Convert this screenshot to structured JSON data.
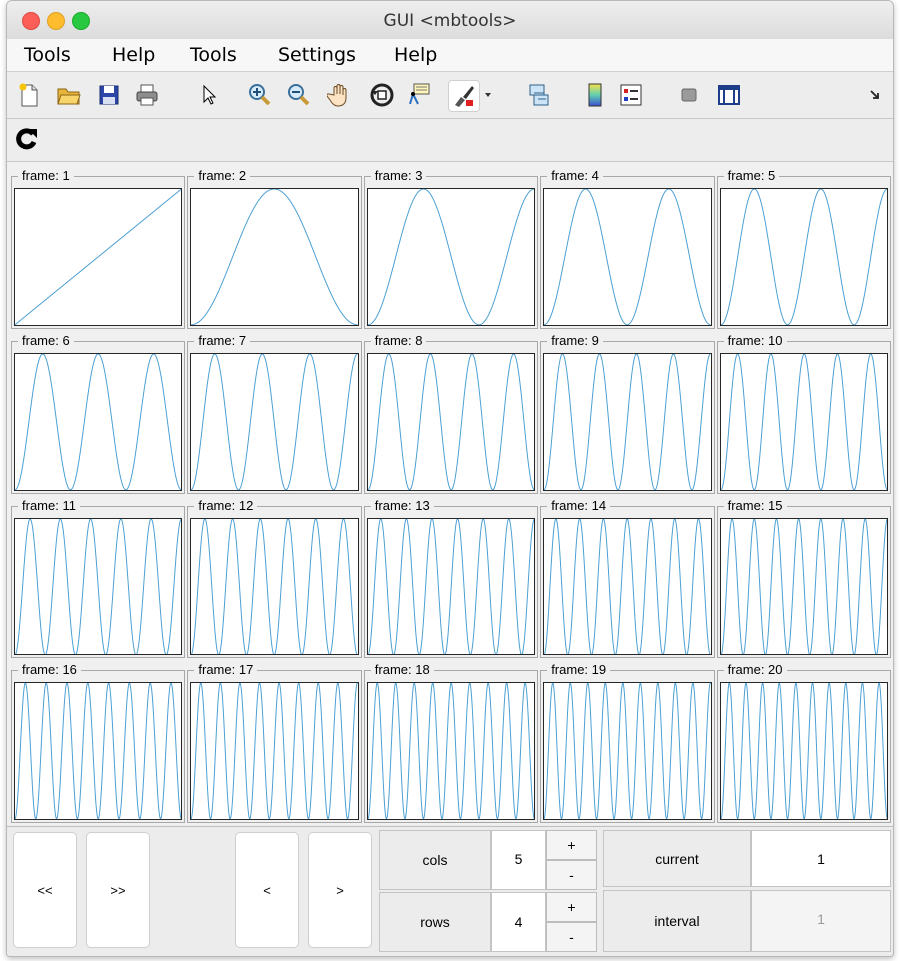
{
  "window": {
    "title": "GUI <mbtools>"
  },
  "menu": [
    "Tools",
    "Help",
    "Tools",
    "Settings",
    "Help"
  ],
  "toolbar": {
    "icons": [
      "new-file-icon",
      "open-folder-icon",
      "save-icon",
      "print-icon",
      "pointer-icon",
      "zoom-in-icon",
      "zoom-out-icon",
      "pan-hand-icon",
      "rotate-3d-icon",
      "data-cursor-icon",
      "brush-icon",
      "brush-dropdown-icon",
      "link-plot-icon",
      "colorbar-icon",
      "legend-icon",
      "hide-plot-tools-icon",
      "show-plot-tools-icon",
      "toolbar-overflow-icon"
    ],
    "refresh_icon": "refresh-icon"
  },
  "frames": [
    {
      "label": "frame: 1",
      "freq": 1
    },
    {
      "label": "frame: 2",
      "freq": 2
    },
    {
      "label": "frame: 3",
      "freq": 3
    },
    {
      "label": "frame: 4",
      "freq": 4
    },
    {
      "label": "frame: 5",
      "freq": 5
    },
    {
      "label": "frame: 6",
      "freq": 6
    },
    {
      "label": "frame: 7",
      "freq": 7
    },
    {
      "label": "frame: 8",
      "freq": 8
    },
    {
      "label": "frame: 9",
      "freq": 9
    },
    {
      "label": "frame: 10",
      "freq": 10
    },
    {
      "label": "frame: 11",
      "freq": 11
    },
    {
      "label": "frame: 12",
      "freq": 12
    },
    {
      "label": "frame: 13",
      "freq": 13
    },
    {
      "label": "frame: 14",
      "freq": 14
    },
    {
      "label": "frame: 15",
      "freq": 15
    },
    {
      "label": "frame: 16",
      "freq": 16
    },
    {
      "label": "frame: 17",
      "freq": 17
    },
    {
      "label": "frame: 18",
      "freq": 18
    },
    {
      "label": "frame: 19",
      "freq": 19
    },
    {
      "label": "frame: 20",
      "freq": 20
    }
  ],
  "line_color": "#4a9fd4",
  "controls": {
    "prev_page": "<<",
    "next_page": ">>",
    "prev": "<",
    "next": ">",
    "cols_label": "cols",
    "cols_value": "5",
    "rows_label": "rows",
    "rows_value": "4",
    "plus": "+",
    "minus": "-",
    "current_label": "current",
    "current_value": "1",
    "interval_label": "interval",
    "interval_value": "1"
  }
}
